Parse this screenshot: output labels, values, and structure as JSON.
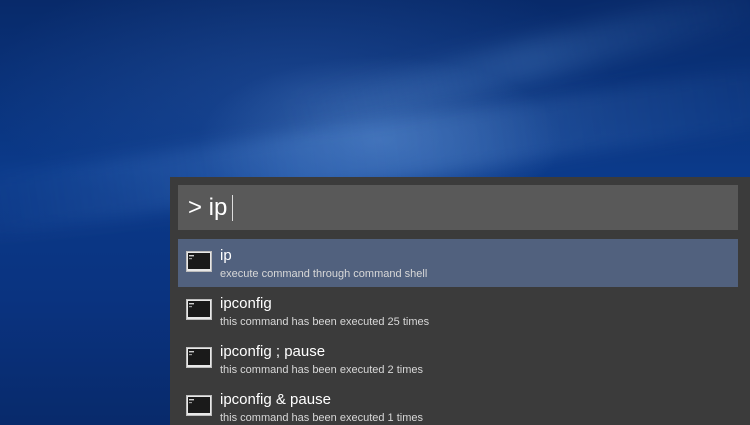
{
  "launcher": {
    "query": "> ip",
    "results": [
      {
        "title": "ip",
        "subtitle": "execute command through command shell",
        "icon": "terminal-icon",
        "selected": true
      },
      {
        "title": "ipconfig",
        "subtitle": "this command has been executed 25 times",
        "icon": "terminal-icon",
        "selected": false
      },
      {
        "title": "ipconfig ; pause",
        "subtitle": "this command has been executed 2 times",
        "icon": "terminal-icon",
        "selected": false
      },
      {
        "title": "ipconfig & pause",
        "subtitle": "this command has been executed 1 times",
        "icon": "terminal-icon",
        "selected": false
      }
    ]
  },
  "colors": {
    "panel_bg": "#3b3b3b",
    "query_bg": "#595959",
    "selected_bg": "#51617e",
    "desktop_blue": "#0b3a8a"
  }
}
